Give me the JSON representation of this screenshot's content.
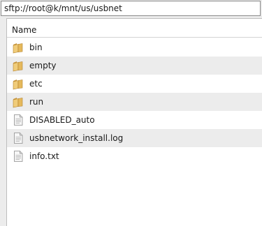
{
  "location": {
    "path": "sftp://root@k/mnt/us/usbnet"
  },
  "file_list": {
    "column_name": "Name",
    "items": [
      {
        "name": "bin",
        "type": "folder"
      },
      {
        "name": "empty",
        "type": "folder"
      },
      {
        "name": "etc",
        "type": "folder"
      },
      {
        "name": "run",
        "type": "folder"
      },
      {
        "name": "DISABLED_auto",
        "type": "file"
      },
      {
        "name": "usbnetwork_install.log",
        "type": "file"
      },
      {
        "name": "info.txt",
        "type": "file"
      }
    ]
  },
  "icons": {
    "folder": "folder-icon",
    "file": "document-icon"
  },
  "colors": {
    "folder_fill": "#e5b95c",
    "row_alt": "#ececec",
    "chrome": "#ececec"
  }
}
